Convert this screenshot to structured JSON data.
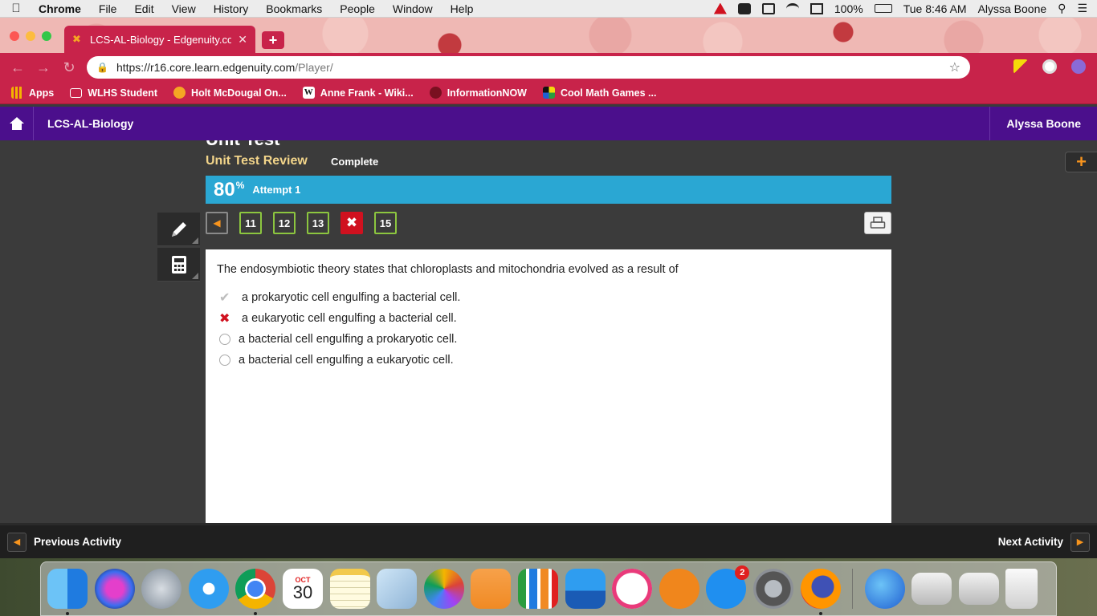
{
  "menubar": {
    "app_name": "Chrome",
    "items": [
      "File",
      "Edit",
      "View",
      "History",
      "Bookmarks",
      "People",
      "Window",
      "Help"
    ],
    "battery": "100%",
    "clock": "Tue 8:46 AM",
    "user": "Alyssa Boone"
  },
  "browser": {
    "tab_title": "LCS-AL-Biology - Edgenuity.co",
    "url_host": "https://r16.core.learn.edgenuity.com",
    "url_path": "/Player/",
    "bookmarks": [
      {
        "label": "Apps",
        "icon": "apps-grid-icon"
      },
      {
        "label": "WLHS Student",
        "icon": "folder-icon"
      },
      {
        "label": "Holt McDougal On...",
        "icon": "holt-icon"
      },
      {
        "label": "Anne Frank - Wiki...",
        "icon": "wikipedia-icon"
      },
      {
        "label": "InformationNOW",
        "icon": "informationnow-icon"
      },
      {
        "label": "Cool Math Games ...",
        "icon": "coolmath-icon"
      }
    ]
  },
  "app": {
    "course_title": "LCS-AL-Biology",
    "user_name": "Alyssa Boone",
    "heading_cut": "Unit Test",
    "review_title": "Unit Test Review",
    "status": "Complete",
    "score": "80",
    "score_unit": "%",
    "attempt": "Attempt 1",
    "question_nav": [
      "11",
      "12",
      "13",
      "15"
    ],
    "question": "The endosymbiotic theory states that chloroplasts and mitochondria evolved as a result of",
    "answers": [
      {
        "text": "a prokaryotic cell engulfing a bacterial cell.",
        "mark": "correct"
      },
      {
        "text": "a eukaryotic cell engulfing a bacterial cell.",
        "mark": "incorrect"
      },
      {
        "text": "a bacterial cell engulfing a prokaryotic cell.",
        "mark": "none"
      },
      {
        "text": "a bacterial cell engulfing a eukaryotic cell.",
        "mark": "none"
      }
    ],
    "prev_label": "Previous Activity",
    "next_label": "Next Activity"
  },
  "dock": {
    "calendar_month": "OCT",
    "calendar_day": "30",
    "app_store_badge": "2"
  },
  "colors": {
    "header_purple": "#4b0f8c",
    "score_blue": "#2aa7d3",
    "review_gold": "#f3d58a",
    "wrong_red": "#d0111f",
    "nav_green": "#8cc63f",
    "chrome_theme": "#c8234a"
  }
}
